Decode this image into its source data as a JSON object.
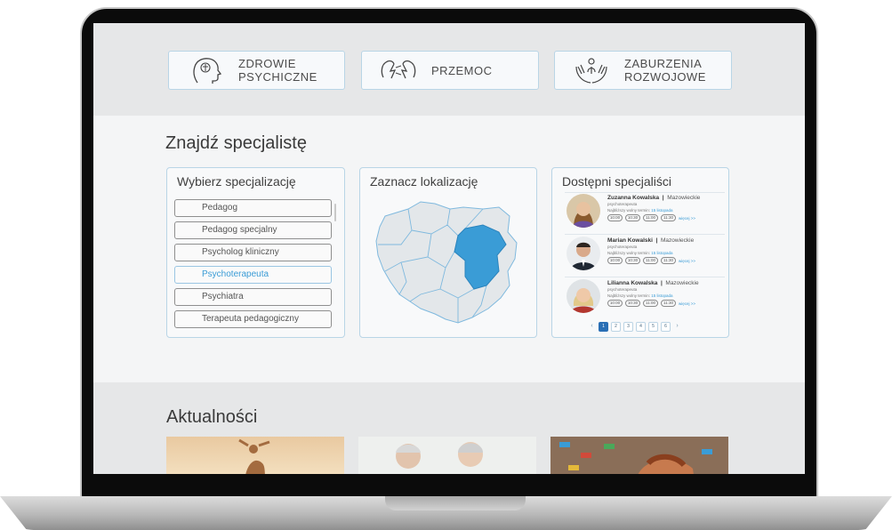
{
  "categories": [
    {
      "line1": "ZDROWIE",
      "line2": "PSYCHICZNE",
      "icon": "head-brain-icon"
    },
    {
      "line1": "PRZEMOC",
      "line2": "",
      "icon": "violence-icon"
    },
    {
      "line1": "ZABURZENIA",
      "line2": "ROZWOJOWE",
      "icon": "hands-child-icon"
    }
  ],
  "finder": {
    "title": "Znajdź specjalistę",
    "specialization": {
      "title": "Wybierz specjalizację",
      "items": [
        "Pedagog",
        "Pedagog specjalny",
        "Psycholog kliniczny",
        "Psychoterapeuta",
        "Psychiatra",
        "Terapeuta pedagogiczny"
      ],
      "selected": "Psychoterapeuta"
    },
    "location": {
      "title": "Zaznacz lokalizację",
      "selected_region": "Mazowieckie",
      "highlight_color": "#3a9cd6"
    },
    "specialists": {
      "title": "Dostępni specjaliści",
      "next_label": "Najbliższy wolny termin:",
      "next_date": "15 listopada",
      "more_label": "więcej >>",
      "slots": [
        "10:00",
        "10:30",
        "11:00",
        "11:30"
      ],
      "people": [
        {
          "name": "Zuzanna Kowalska",
          "region": "Mazowieckie",
          "role": "psychoterapeuta"
        },
        {
          "name": "Marian Kowalski",
          "region": "Mazowieckie",
          "role": "psychoterapeuta"
        },
        {
          "name": "Lilianna Kowalska",
          "region": "Mazowieckie",
          "role": "psychoterapeuta"
        }
      ],
      "pages": [
        "1",
        "2",
        "3",
        "4",
        "5",
        "6"
      ],
      "current_page": "1"
    }
  },
  "news": {
    "title": "Aktualności"
  },
  "colors": {
    "accent": "#3a9cd6",
    "border": "#b9d5e6",
    "page_active": "#2a6fb5"
  }
}
